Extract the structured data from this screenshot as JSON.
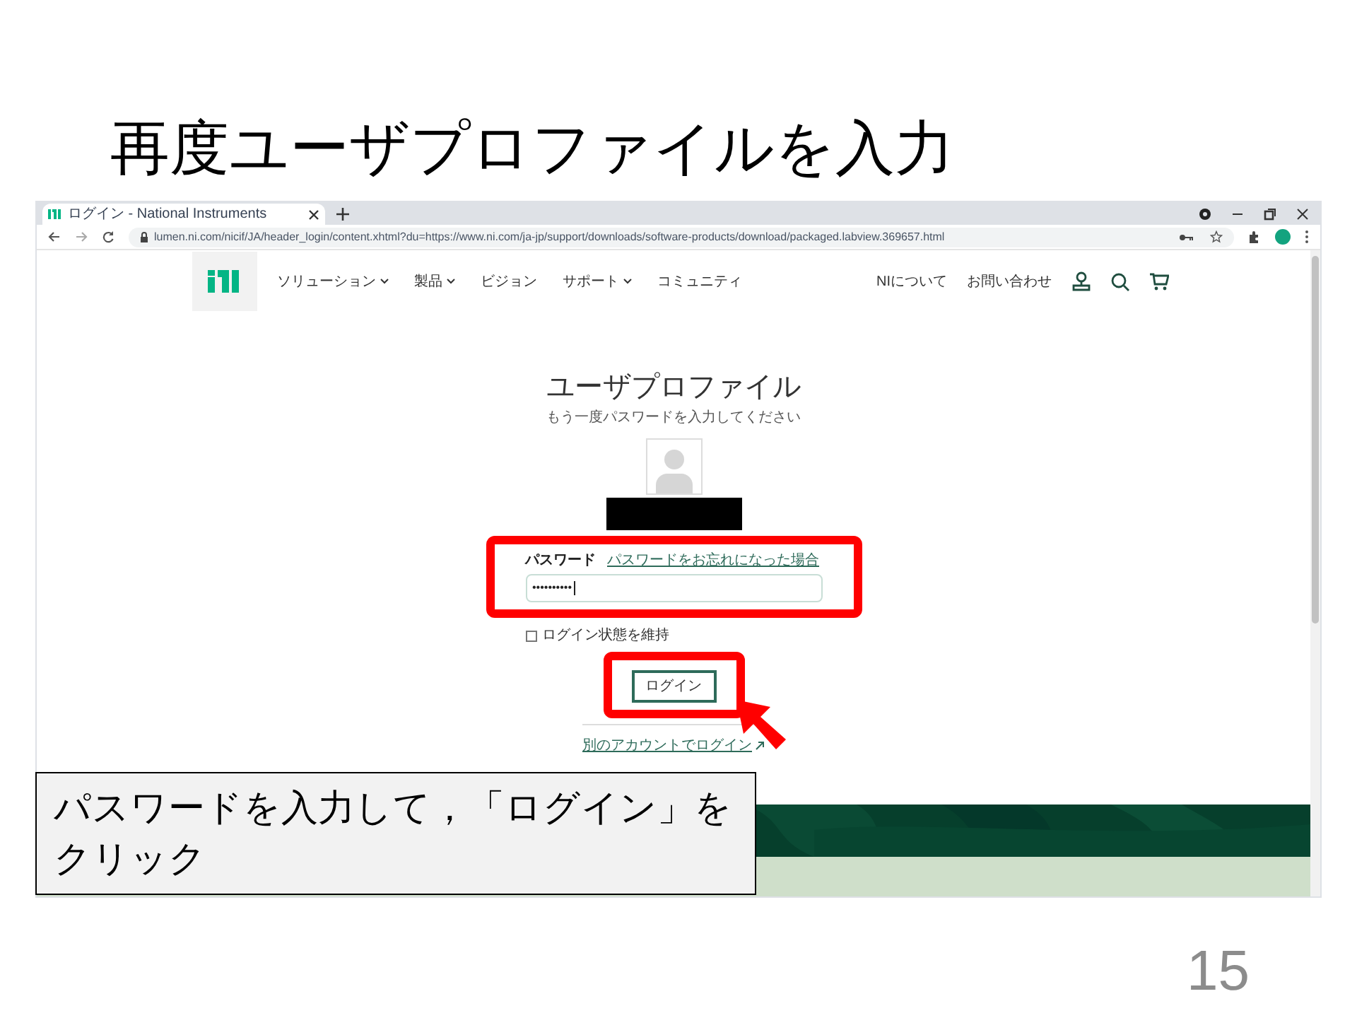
{
  "slide": {
    "title": "再度ユーザプロファイルを入力",
    "page_number": "15"
  },
  "browser": {
    "tab_title": "ログイン - National Instruments",
    "address": "lumen.ni.com/nicif/JA/header_login/content.xhtml?du=https://www.ni.com/ja-jp/support/downloads/software-products/download/packaged.labview.369657.html"
  },
  "site_nav": {
    "items": [
      {
        "label": "ソリューション",
        "dropdown": true
      },
      {
        "label": "製品",
        "dropdown": true
      },
      {
        "label": "ビジョン",
        "dropdown": false
      },
      {
        "label": "サポート",
        "dropdown": true
      },
      {
        "label": "コミュニティ",
        "dropdown": false
      }
    ],
    "right_links": [
      "NIについて",
      "お問い合わせ"
    ]
  },
  "login": {
    "title": "ユーザプロファイル",
    "subtitle": "もう一度パスワードを入力してください",
    "password_label": "パスワード",
    "forgot_link": "パスワードをお忘れになった場合",
    "password_value": "••••••••••",
    "remember": {
      "label": "ログイン状態を維持",
      "checked": false
    },
    "button": "ログイン",
    "switch_account": "別のアカウントでログイン"
  },
  "callout": "パスワードを入力して，「ログイン」をクリック"
}
